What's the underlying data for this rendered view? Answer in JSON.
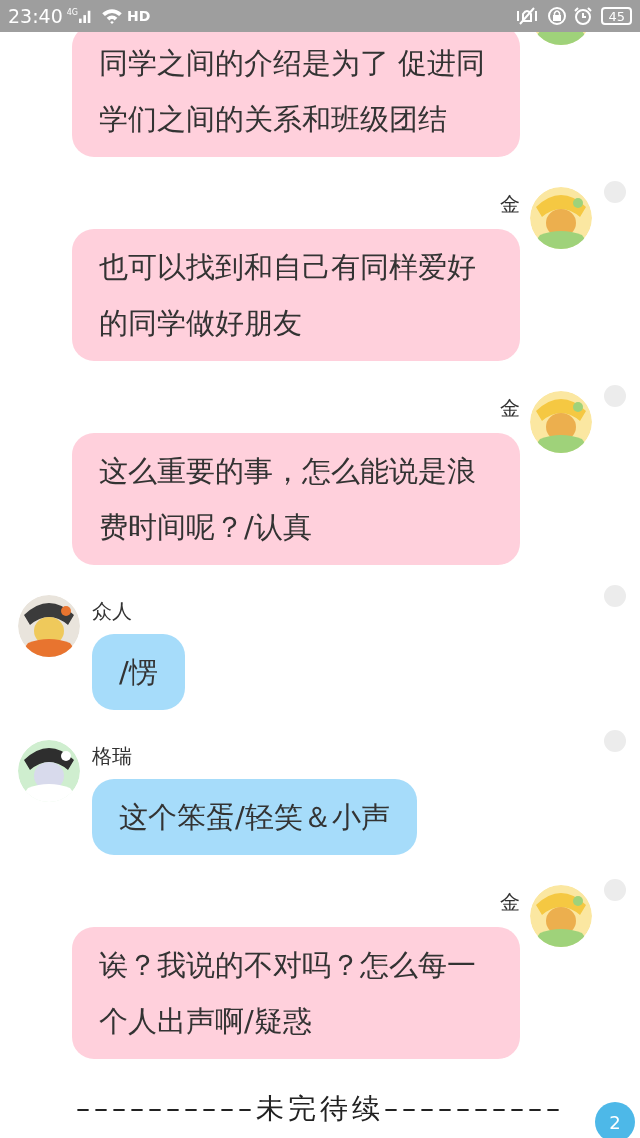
{
  "status_bar": {
    "time": "23:40",
    "network": "4G",
    "hd": "HD",
    "battery": "45"
  },
  "messages": [
    {
      "kind": "outgoing",
      "text": "同学之间的介绍是为了 促进同学们之间的关系和班级团结"
    },
    {
      "kind": "outgoing",
      "name": "金",
      "text": "也可以找到和自己有同样爱好的同学做好朋友",
      "selected": false
    },
    {
      "kind": "outgoing",
      "name": "金",
      "text": "这么重要的事，怎么能说是浪费时间呢？/认真",
      "selected": false
    },
    {
      "kind": "incoming",
      "name": "众人",
      "text": "/愣",
      "selected": false
    },
    {
      "kind": "incoming",
      "name": "格瑞",
      "text": "这个笨蛋/轻笑＆小声",
      "selected": false
    },
    {
      "kind": "outgoing",
      "name": "金",
      "text": "诶？我说的不对吗？怎么每一个人出声啊/疑惑",
      "selected": false
    }
  ],
  "footer": "––––––––––未完待续––––––––––",
  "unread_badge": "2"
}
